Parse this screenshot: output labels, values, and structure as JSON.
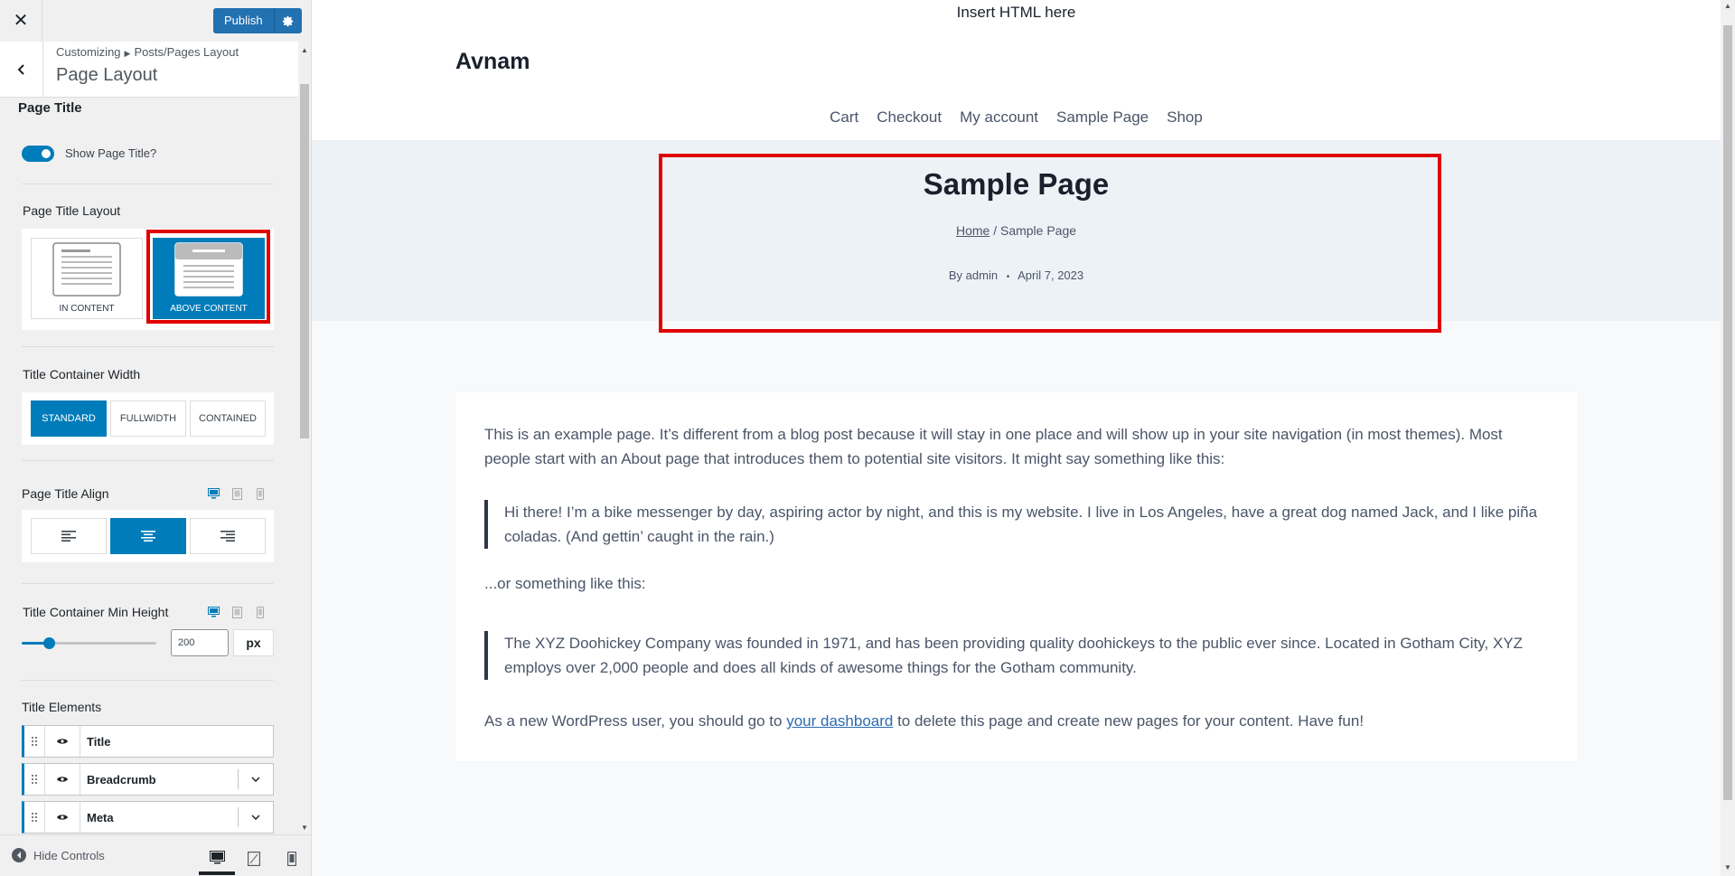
{
  "sidebar": {
    "publish_label": "Publish",
    "breadcrumb": {
      "root": "Customizing",
      "parent": "Posts/Pages Layout"
    },
    "section_title": "Page Layout",
    "page_title_heading": "Page Title",
    "show_title_label": "Show Page Title?",
    "show_title_enabled": true,
    "title_layout": {
      "label": "Page Title Layout",
      "options": [
        {
          "label": "IN CONTENT",
          "selected": false
        },
        {
          "label": "ABOVE CONTENT",
          "selected": true
        }
      ]
    },
    "container_width": {
      "label": "Title Container Width",
      "options": [
        {
          "label": "STANDARD",
          "selected": true
        },
        {
          "label": "FULLWIDTH",
          "selected": false
        },
        {
          "label": "CONTAINED",
          "selected": false
        }
      ]
    },
    "title_align": {
      "label": "Page Title Align",
      "options": [
        "left",
        "center",
        "right"
      ],
      "selected": "center"
    },
    "min_height": {
      "label": "Title Container Min Height",
      "value": "200",
      "unit": "px",
      "slider_fraction": 0.2
    },
    "title_elements": {
      "label": "Title Elements",
      "items": [
        {
          "name": "Title",
          "expandable": false
        },
        {
          "name": "Breadcrumb",
          "expandable": true
        },
        {
          "name": "Meta",
          "expandable": true
        }
      ]
    },
    "footer": {
      "hide_controls_label": "Hide Controls",
      "active_device": "desktop"
    }
  },
  "preview": {
    "top_html": "Insert HTML here",
    "site_title": "Avnam",
    "nav": [
      "Cart",
      "Checkout",
      "My account",
      "Sample Page",
      "Shop"
    ],
    "hero": {
      "title": "Sample Page",
      "breadcrumb_home": "Home",
      "breadcrumb_sep": " / ",
      "breadcrumb_current": "Sample Page",
      "meta_author": "By admin",
      "meta_sep": "•",
      "meta_date": "April 7, 2023"
    },
    "content": {
      "p1": "This is an example page. It’s different from a blog post because it will stay in one place and will show up in your site navigation (in most themes). Most people start with an About page that introduces them to potential site visitors. It might say something like this:",
      "quote1": "Hi there! I’m a bike messenger by day, aspiring actor by night, and this is my website. I live in Los Angeles, have a great dog named Jack, and I like piña coladas. (And gettin’ caught in the rain.)",
      "p2": "...or something like this:",
      "quote2": "The XYZ Doohickey Company was founded in 1971, and has been providing quality doohickeys to the public ever since. Located in Gotham City, XYZ employs over 2,000 people and does all kinds of awesome things for the Gotham community.",
      "p3_before": "As a new WordPress user, you should go to ",
      "p3_link": "your dashboard",
      "p3_after": " to delete this page and create new pages for your content. Have fun!"
    }
  },
  "colors": {
    "accent": "#007cba",
    "publish": "#2271b1",
    "highlight": "#e00000",
    "hero_bg": "#edf2f7"
  },
  "icons": [
    "close-icon",
    "gear-icon",
    "back-arrow-icon",
    "desktop-icon",
    "tablet-icon",
    "mobile-icon",
    "drag-handle-icon",
    "eye-icon",
    "chevron-down-icon",
    "hide-controls-icon",
    "align-left-icon",
    "align-center-icon",
    "align-right-icon",
    "page-layout-icon"
  ]
}
